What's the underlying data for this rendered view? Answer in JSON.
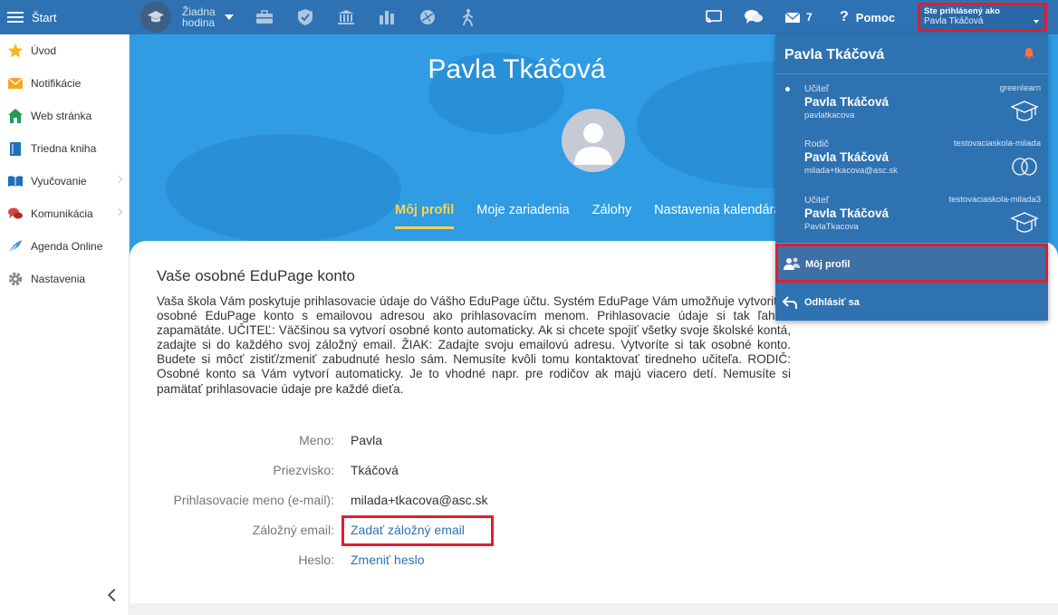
{
  "topbar": {
    "start_label": "Štart",
    "lesson_label": "Žiadna hodina",
    "icons": [
      "briefcase-icon",
      "shield-icon",
      "bank-icon",
      "bar-chart-icon",
      "ball-icon",
      "walking-icon"
    ],
    "cast_icon": "cast-icon",
    "chat_icon": "chat-icon",
    "messages_count": "7",
    "help_label": "Pomoc",
    "logged_in_label": "Ste prihlásený ako",
    "logged_in_user": "Pavla Tkáčová"
  },
  "sidebar": {
    "items": [
      {
        "label": "Úvod",
        "icon": "star-icon",
        "chevron": false
      },
      {
        "label": "Notifikácie",
        "icon": "envelope-icon",
        "chevron": false
      },
      {
        "label": "Web stránka",
        "icon": "house-icon",
        "chevron": false
      },
      {
        "label": "Triedna kniha",
        "icon": "book-icon",
        "chevron": false
      },
      {
        "label": "Vyučovanie",
        "icon": "open-book-icon",
        "chevron": true
      },
      {
        "label": "Komunikácia",
        "icon": "chat-bubbles-icon",
        "chevron": true
      },
      {
        "label": "Agenda Online",
        "icon": "feather-icon",
        "chevron": false
      },
      {
        "label": "Nastavenia",
        "icon": "gear-icon",
        "chevron": false
      }
    ]
  },
  "profile": {
    "name": "Pavla Tkáčová",
    "tabs": [
      "Môj profil",
      "Moje zariadenia",
      "Zálohy",
      "Nastavenia kalendára"
    ],
    "active_tab": 0
  },
  "account": {
    "title": "Vaše osobné EduPage konto",
    "description": "Vaša škola Vám poskytuje prihlasovacie údaje do Vášho EduPage účtu. Systém EduPage Vám umožňuje vytvoriť si osobné EduPage konto s emailovou adresou ako prihlasovacím menom. Prihlasovacie údaje si tak ľahšie zapamätáte. UČITEĽ: Väčšinou sa vytvorí osobné konto automaticky. Ak si chcete spojiť všetky svoje školské kontá, zadajte si do každého svoj záložný email. ŽIAK: Zadajte svoju emailovú adresu. Vytvoríte si tak osobné konto. Budete si môcť zistiť/zmeniť zabudnuté heslo sám. Nemusíte kvôli tomu kontaktovať tiredneho učiteľa. RODIČ: Osobné konto sa Vám vytvorí automaticky. Je to vhodné napr. pre rodičov ak majú viacero detí. Nemusíte si pamätať prihlasovacie údaje pre každé dieťa.",
    "fields": [
      {
        "label": "Meno:",
        "value": "Pavla",
        "link": false
      },
      {
        "label": "Priezvisko:",
        "value": "Tkáčová",
        "link": false
      },
      {
        "label": "Prihlasovacie meno (e-mail):",
        "value": "milada+tkacova@asc.sk",
        "link": false
      },
      {
        "label": "Záložný email:",
        "value": "Zadať záložný email",
        "link": true
      },
      {
        "label": "Heslo:",
        "value": "Zmeniť heslo",
        "link": true
      }
    ]
  },
  "dropdown": {
    "name": "Pavla Tkáčová",
    "accounts": [
      {
        "role": "Učiteľ",
        "name": "Pavla Tkáčová",
        "login": "pavlatkacova",
        "school": "greenlearn",
        "icon": "teacher-icon",
        "current": true
      },
      {
        "role": "Rodič",
        "name": "Pavla Tkáčová",
        "login": "milada+tkacova@asc.sk",
        "school": "testovaciaskola-milada",
        "icon": "parent-icon",
        "current": false
      },
      {
        "role": "Učiteľ",
        "name": "Pavla Tkáčová",
        "login": "PavlaTkacova",
        "school": "testovaciaskola-milada3",
        "icon": "teacher-icon",
        "current": false
      }
    ],
    "profile_label": "Môj profil",
    "logout_label": "Odhlásiť sa"
  },
  "colors": {
    "topbar": "#2e72b4",
    "hero": "#2f9ce4",
    "active_tab": "#ffd34d",
    "highlight": "#e01e2f",
    "link": "#2e72b4"
  }
}
